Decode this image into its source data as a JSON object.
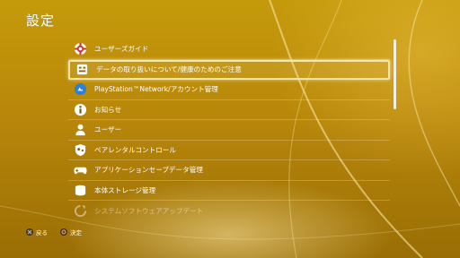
{
  "header": {
    "title": "設定"
  },
  "menu": {
    "items": [
      {
        "label": "ユーザーズガイド",
        "icon": "user-guide-icon"
      },
      {
        "label": "データの取り扱いについて/健康のためのご注意",
        "icon": "data-handling-icon"
      },
      {
        "label": "PlayStation™Network/アカウント管理",
        "icon": "psn-icon"
      },
      {
        "label": "お知らせ",
        "icon": "info-icon"
      },
      {
        "label": "ユーザー",
        "icon": "user-icon"
      },
      {
        "label": "ペアレンタルコントロール",
        "icon": "parental-control-icon"
      },
      {
        "label": "アプリケーションセーブデータ管理",
        "icon": "gamepad-icon"
      },
      {
        "label": "本体ストレージ管理",
        "icon": "storage-icon"
      },
      {
        "label": "システムソフトウェアアップデート",
        "icon": "system-update-icon"
      }
    ],
    "selected_index": 1
  },
  "footer": {
    "back_label": "戻る",
    "confirm_label": "決定"
  }
}
